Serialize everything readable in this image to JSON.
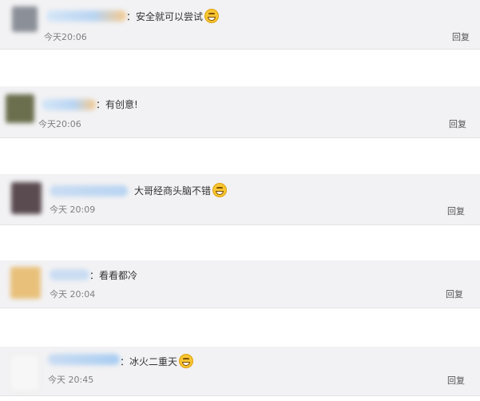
{
  "comments": [
    {
      "text": "安全就可以尝试",
      "emoji": "grin-emoji",
      "time": "今天20:06",
      "reply": "回复",
      "avatar_color": "#8b8f97"
    },
    {
      "text": "有创意!",
      "time": "今天20:06",
      "reply": "回复",
      "avatar_color": "#6b6f4e"
    },
    {
      "text": "大哥经商头脑不错",
      "emoji": "laughing-emoji",
      "time": "今天 20:09",
      "reply": "回复",
      "avatar_color": "#5a4b50"
    },
    {
      "text": "看看都冷",
      "time": "今天 20:04",
      "reply": "回复",
      "avatar_color": "#e8c07a"
    },
    {
      "text": "冰火二重天",
      "emoji": "laughing-emoji",
      "time": "今天 20:45",
      "reply": "回复",
      "avatar_color": "#f4f4f4"
    }
  ],
  "colors": {
    "card_background": "#f2f2f4",
    "username_blur": "#b8d4f2",
    "timestamp": "#7f7f7f"
  }
}
